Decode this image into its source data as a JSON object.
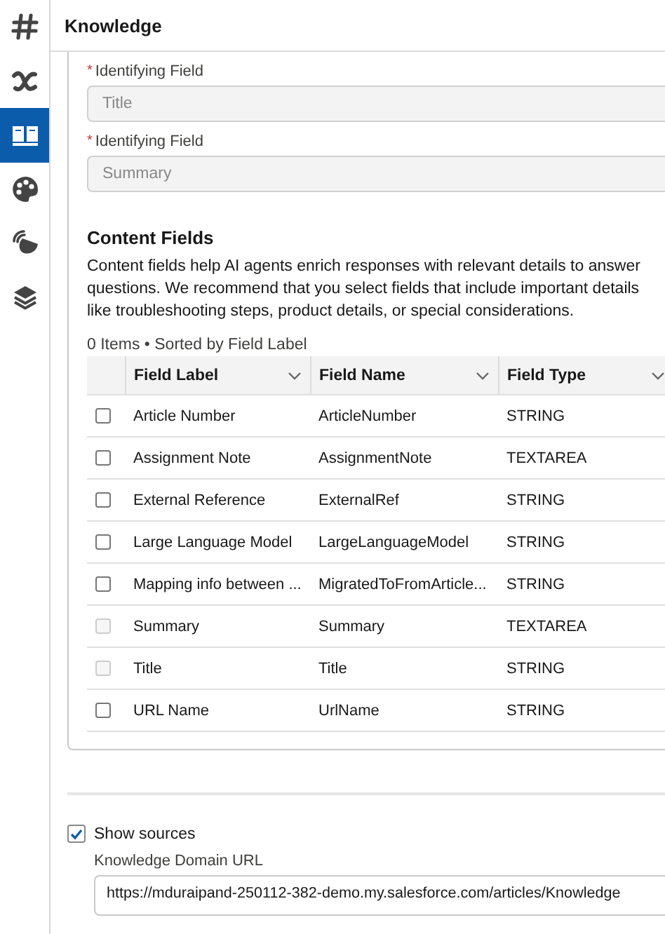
{
  "sidebar": {
    "items": [
      {
        "kind": "hash",
        "selected": false
      },
      {
        "kind": "variable",
        "selected": false
      },
      {
        "kind": "book",
        "selected": true
      },
      {
        "kind": "palette",
        "selected": false
      },
      {
        "kind": "dish",
        "selected": false
      },
      {
        "kind": "layers",
        "selected": false
      }
    ]
  },
  "header": {
    "title": "Knowledge"
  },
  "identifying_fields": [
    {
      "required_mark": "*",
      "label": "Identifying Field",
      "value": "Title",
      "disabled": true
    },
    {
      "required_mark": "*",
      "label": "Identifying Field",
      "value": "Summary",
      "disabled": true
    }
  ],
  "content_fields": {
    "heading": "Content Fields",
    "description": "Content fields help AI agents enrich responses with relevant details to answer questions. We recommend that you select fields that include important details like troubleshooting steps, product details, or special considerations.",
    "table": {
      "summary": "0 Items • Sorted by Field Label",
      "columns": [
        "Field Label",
        "Field Name",
        "Field Type"
      ],
      "rows": [
        {
          "checked": false,
          "disabled": false,
          "cells": [
            "Article Number",
            "ArticleNumber",
            "STRING"
          ]
        },
        {
          "checked": false,
          "disabled": false,
          "cells": [
            "Assignment Note",
            "AssignmentNote",
            "TEXTAREA"
          ]
        },
        {
          "checked": false,
          "disabled": false,
          "cells": [
            "External Reference",
            "ExternalRef",
            "STRING"
          ]
        },
        {
          "checked": false,
          "disabled": false,
          "cells": [
            "Large Language Model",
            "LargeLanguageModel",
            "STRING"
          ]
        },
        {
          "checked": false,
          "disabled": false,
          "cells": [
            "Mapping info between ...",
            "MigratedToFromArticle...",
            "STRING"
          ]
        },
        {
          "checked": false,
          "disabled": true,
          "cells": [
            "Summary",
            "Summary",
            "TEXTAREA"
          ]
        },
        {
          "checked": false,
          "disabled": true,
          "cells": [
            "Title",
            "Title",
            "STRING"
          ]
        },
        {
          "checked": false,
          "disabled": false,
          "cells": [
            "URL Name",
            "UrlName",
            "STRING"
          ]
        }
      ]
    }
  },
  "show_sources": {
    "label": "Show sources",
    "checked": true
  },
  "domain_url": {
    "label": "Knowledge Domain URL",
    "value": "https://mduraipand-250112-382-demo.my.salesforce.com/articles/Knowledge"
  }
}
